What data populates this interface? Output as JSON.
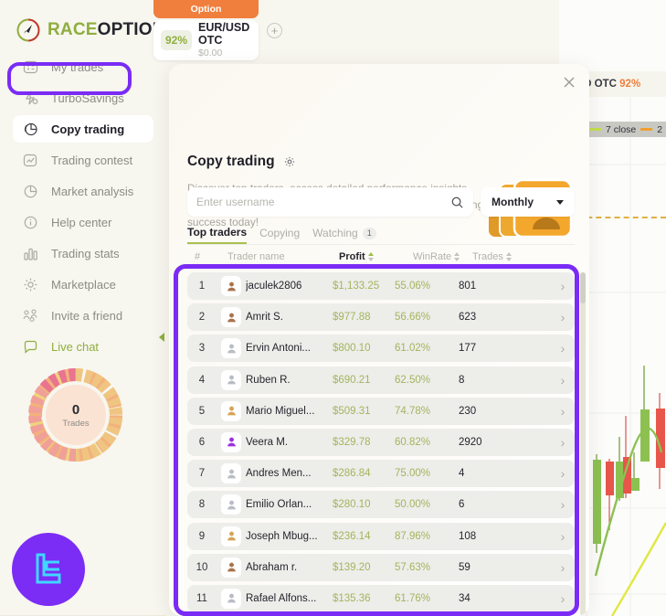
{
  "brand": {
    "race": "RACE",
    "option": "OPTION"
  },
  "asset_tab": {
    "label": "Option",
    "percent": "92%",
    "name": "EUR/USD OTC",
    "balance": "$0.00",
    "add_icon": "plus-icon"
  },
  "sidebar": {
    "items": [
      {
        "label": "My trades",
        "icon": "my-trades-icon",
        "active": false
      },
      {
        "label": "TurboSavings",
        "icon": "turbo-savings-icon",
        "active": false
      },
      {
        "label": "Copy trading",
        "icon": "copy-trading-icon",
        "active": true
      },
      {
        "label": "Trading contest",
        "icon": "trading-contest-icon",
        "active": false
      },
      {
        "label": "Market analysis",
        "icon": "market-analysis-icon",
        "active": false
      },
      {
        "label": "Help center",
        "icon": "help-center-icon",
        "active": false
      },
      {
        "label": "Trading stats",
        "icon": "trading-stats-icon",
        "active": false
      },
      {
        "label": "Marketplace",
        "icon": "marketplace-icon",
        "active": false
      },
      {
        "label": "Invite a friend",
        "icon": "invite-friend-icon",
        "active": false
      },
      {
        "label": "Live chat",
        "icon": "live-chat-icon",
        "active": false
      }
    ],
    "gauge": {
      "value": "0",
      "label": "Trades"
    },
    "badge": {
      "monogram": "LC"
    }
  },
  "chart_panel": {
    "title": "/USD OTC",
    "percent": "92%",
    "legend": [
      {
        "label": "7 close",
        "color": "#c2de4f"
      },
      {
        "label": "2",
        "color": "#f0a030"
      }
    ]
  },
  "modal": {
    "close_icon": "close-icon",
    "title": "Copy trading",
    "settings_icon": "gear-icon",
    "description": "Discover top traders, access detailed performance insights, and customize your copying settings effortlessly.\nStart copying success today!",
    "search": {
      "placeholder": "Enter username",
      "value": "",
      "icon": "search-icon"
    },
    "period": {
      "selected": "Monthly",
      "icon": "chevron-down-icon"
    },
    "tabs": [
      {
        "label": "Top traders",
        "active": true,
        "badge": ""
      },
      {
        "label": "Copying",
        "active": false,
        "badge": ""
      },
      {
        "label": "Watching",
        "active": false,
        "badge": "1"
      }
    ],
    "table": {
      "columns": [
        "#",
        "Trader name",
        "Profit",
        "WinRate",
        "Trades"
      ],
      "sorted_column": "Profit",
      "sort_direction": "asc",
      "rows": [
        {
          "rank": "1",
          "name": "jaculek2806",
          "profit": "$1,133.25",
          "winrate": "55.06%",
          "trades": "801",
          "avatar_color": "#a9734b"
        },
        {
          "rank": "2",
          "name": "Amrit S.",
          "profit": "$977.88",
          "winrate": "56.66%",
          "trades": "623",
          "avatar_color": "#a9734b"
        },
        {
          "rank": "3",
          "name": "Ervin Antoni...",
          "profit": "$800.10",
          "winrate": "61.02%",
          "trades": "177",
          "avatar_color": "#b9bcc4"
        },
        {
          "rank": "4",
          "name": "Ruben R.",
          "profit": "$690.21",
          "winrate": "62.50%",
          "trades": "8",
          "avatar_color": "#b9bcc4"
        },
        {
          "rank": "5",
          "name": "Mario Miguel...",
          "profit": "$509.31",
          "winrate": "74.78%",
          "trades": "230",
          "avatar_color": "#d6a457"
        },
        {
          "rank": "6",
          "name": "Veera M.",
          "profit": "$329.78",
          "winrate": "60.82%",
          "trades": "2920",
          "avatar_color": "#9b2fe0"
        },
        {
          "rank": "7",
          "name": "Andres Men...",
          "profit": "$286.84",
          "winrate": "75.00%",
          "trades": "4",
          "avatar_color": "#b9bcc4"
        },
        {
          "rank": "8",
          "name": "Emilio Orlan...",
          "profit": "$280.10",
          "winrate": "50.00%",
          "trades": "6",
          "avatar_color": "#b9bcc4"
        },
        {
          "rank": "9",
          "name": "Joseph Mbug...",
          "profit": "$236.14",
          "winrate": "87.96%",
          "trades": "108",
          "avatar_color": "#d6a457"
        },
        {
          "rank": "10",
          "name": "Abraham r.",
          "profit": "$139.20",
          "winrate": "57.63%",
          "trades": "59",
          "avatar_color": "#a9734b"
        },
        {
          "rank": "11",
          "name": "Rafael Alfons...",
          "profit": "$135.36",
          "winrate": "61.76%",
          "trades": "34",
          "avatar_color": "#b9bcc4"
        }
      ],
      "row_arrow_icon": "chevron-right-icon"
    }
  },
  "colors": {
    "accent_purple": "#7a2bf5",
    "brand_green": "#8fae3e",
    "orange": "#f07e3c",
    "profit_green": "#a3b55c",
    "page_bg": "#f7f6ef"
  }
}
